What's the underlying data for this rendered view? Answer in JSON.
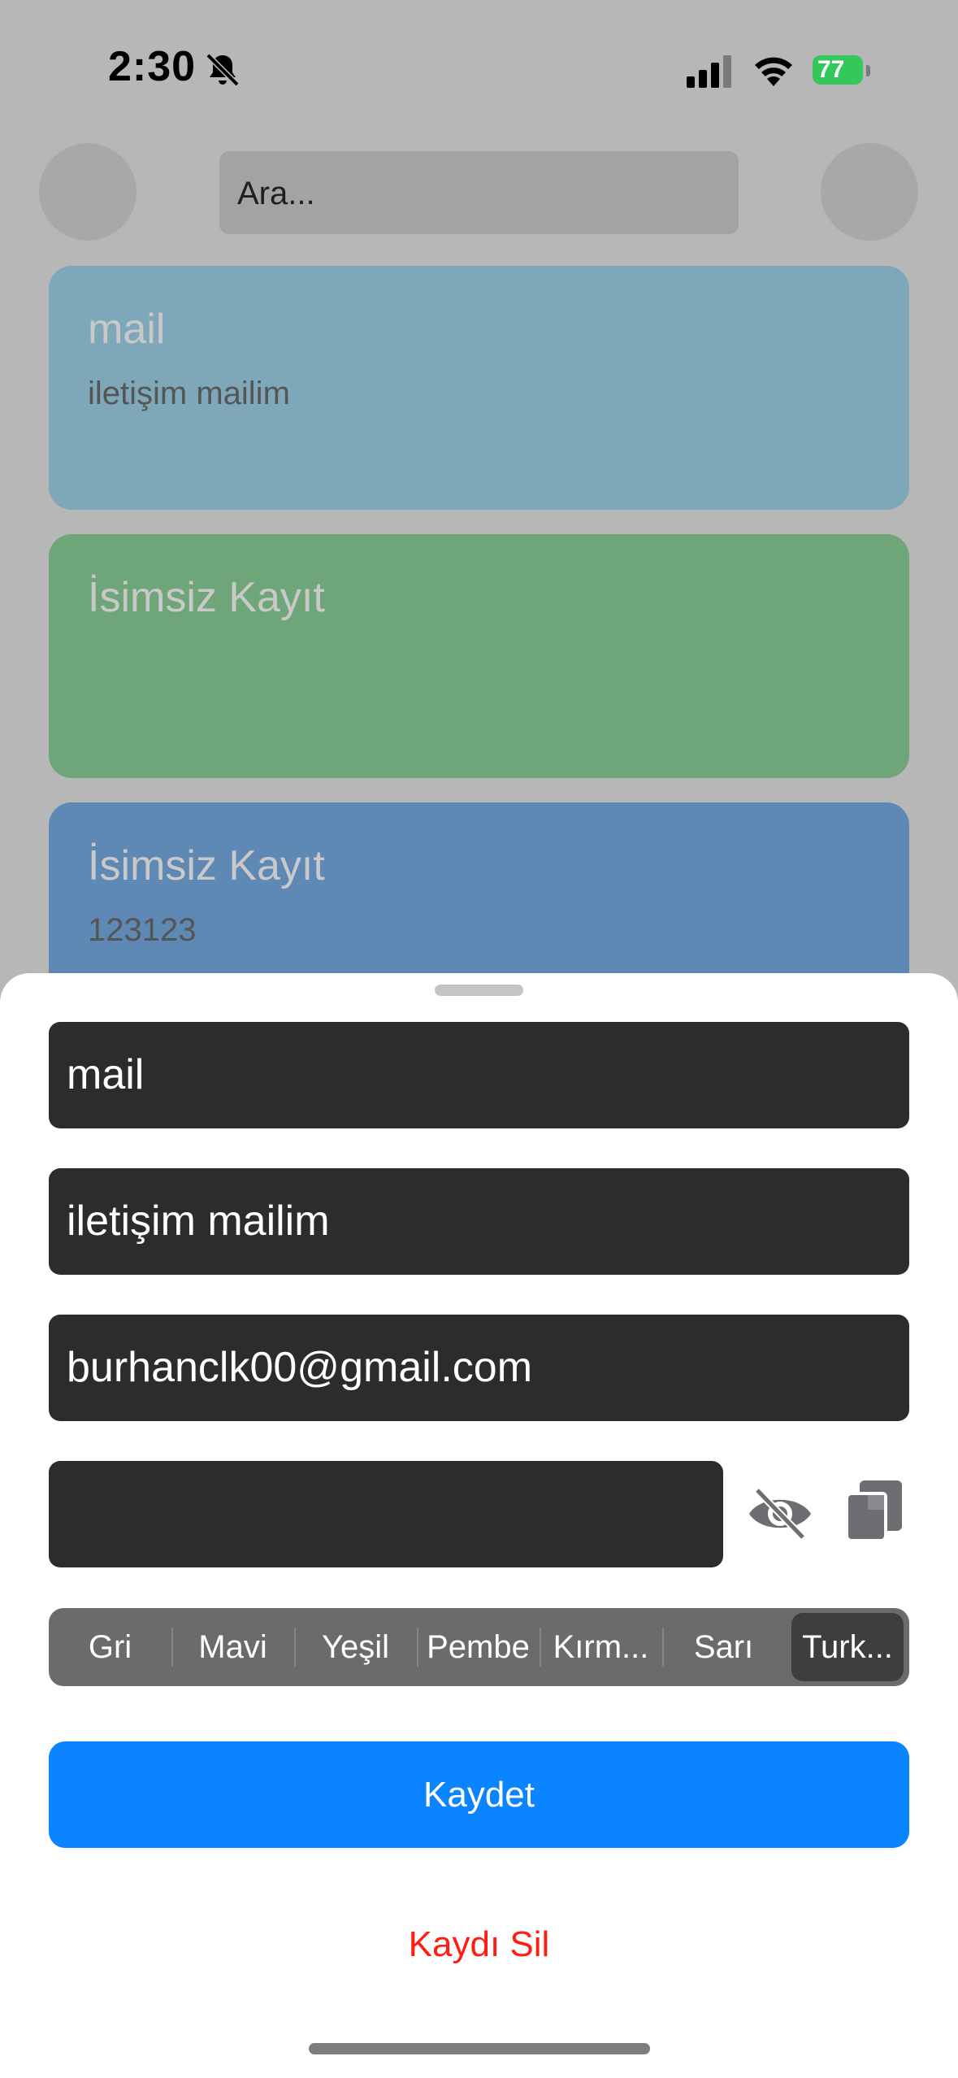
{
  "status": {
    "time": "2:30",
    "battery": "77"
  },
  "search": {
    "placeholder": "Ara..."
  },
  "records": [
    {
      "title": "mail",
      "subtitle": "iletişim mailim",
      "color": "#7ea7b9"
    },
    {
      "title": "İsimsiz Kayıt",
      "subtitle": "",
      "color": "#6fa679"
    },
    {
      "title": "İsimsiz Kayıt",
      "subtitle": "123123",
      "color": "#5f89b5"
    }
  ],
  "editor": {
    "title_value": "mail",
    "description_value": "iletişim mailim",
    "email_value": "burhanclk00@gmail.com",
    "password_value": "",
    "colors": [
      "Gri",
      "Mavi",
      "Yeşil",
      "Pembe",
      "Kırm...",
      "Sarı",
      "Turk..."
    ],
    "selected_color": "Turk...",
    "save_label": "Kaydet",
    "delete_label": "Kaydı Sil"
  },
  "theme": {
    "accent": "#0a84ff",
    "destructive": "#ff1c12",
    "field_bg": "#2c2c2e"
  }
}
